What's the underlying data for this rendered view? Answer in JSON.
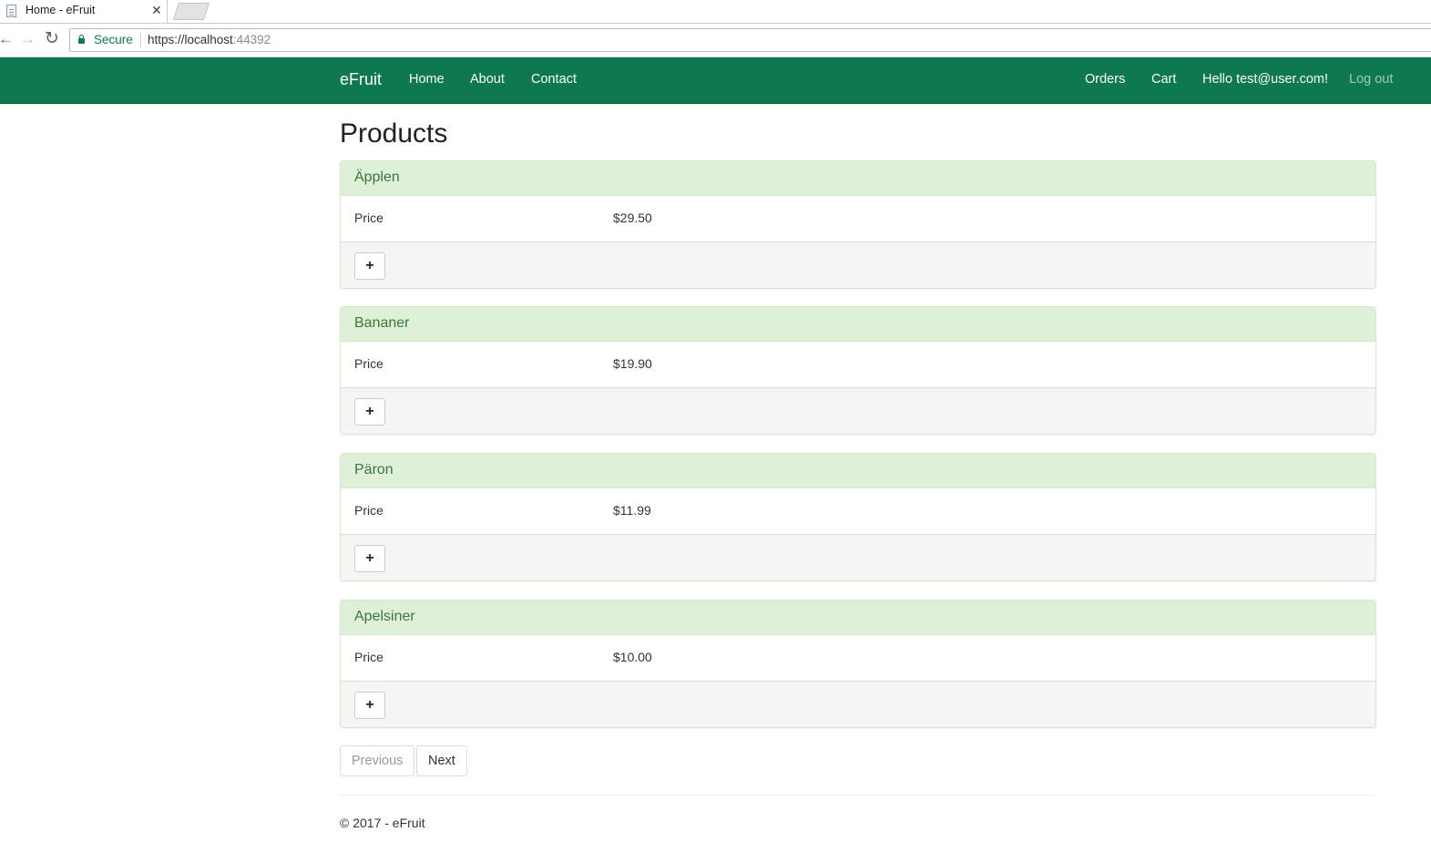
{
  "browser": {
    "tab_title": "Home - eFruit",
    "tab_close": "✕",
    "secure_label": "Secure",
    "url_host": "https://localhost",
    "url_port": ":44392"
  },
  "navbar": {
    "brand": "eFruit",
    "links": [
      "Home",
      "About",
      "Contact"
    ],
    "right": {
      "orders": "Orders",
      "cart": "Cart",
      "greeting": "Hello test@user.com!",
      "logout": "Log out"
    },
    "color": "#0e784e"
  },
  "page": {
    "title": "Products"
  },
  "products": [
    {
      "name": "Äpplen",
      "price_label": "Price",
      "price": "$29.50",
      "add_label": "+"
    },
    {
      "name": "Bananer",
      "price_label": "Price",
      "price": "$19.90",
      "add_label": "+"
    },
    {
      "name": "Päron",
      "price_label": "Price",
      "price": "$11.99",
      "add_label": "+"
    },
    {
      "name": "Apelsiner",
      "price_label": "Price",
      "price": "$10.00",
      "add_label": "+"
    }
  ],
  "pager": {
    "previous": "Previous",
    "next": "Next"
  },
  "footer": {
    "text": "© 2017 - eFruit"
  },
  "icons": [
    "page-icon",
    "close-icon",
    "back-arrow-icon",
    "forward-arrow-icon",
    "reload-icon",
    "lock-icon",
    "plus-icon"
  ]
}
